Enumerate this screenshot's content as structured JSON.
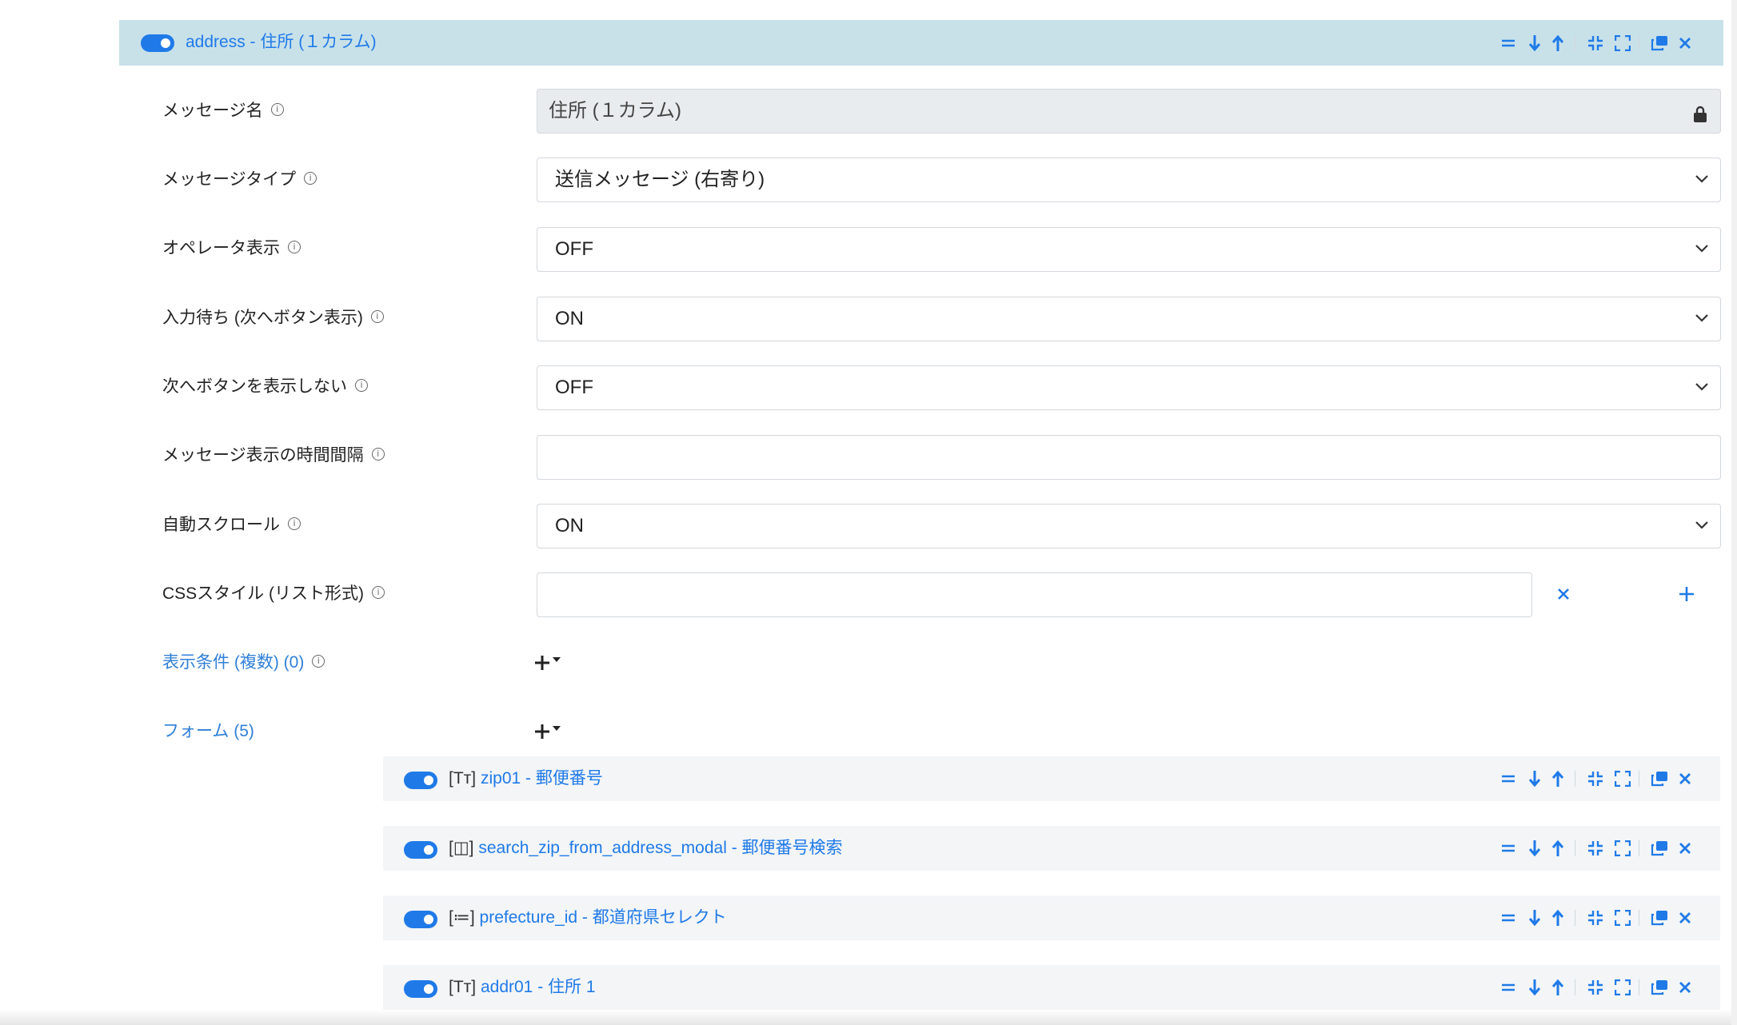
{
  "header": {
    "title": "address - 住所 (１カラム)",
    "toggle_on": true
  },
  "fields": [
    {
      "label": "メッセージ名",
      "value": "住所 (１カラム)",
      "type": "readonly"
    },
    {
      "label": "メッセージタイプ",
      "value": "送信メッセージ (右寄り)",
      "type": "select"
    },
    {
      "label": "オペレータ表示",
      "value": "OFF",
      "type": "select"
    },
    {
      "label": "入力待ち (次へボタン表示)",
      "value": "ON",
      "type": "select"
    },
    {
      "label": "次へボタンを表示しない",
      "value": "OFF",
      "type": "select"
    },
    {
      "label": "メッセージ表示の時間間隔",
      "value": "",
      "type": "text"
    },
    {
      "label": "自動スクロール",
      "value": "ON",
      "type": "select"
    },
    {
      "label": "CSSスタイル (リスト形式)",
      "value": "",
      "type": "text"
    }
  ],
  "conditions": {
    "label": "表示条件 (複数) (0)"
  },
  "forms": {
    "label": "フォーム (5)",
    "items": [
      {
        "icon": "[Tт]",
        "icon_name": "text-field-icon",
        "title": "zip01 - 郵便番号"
      },
      {
        "icon": "[◫]",
        "icon_name": "modal-icon",
        "title": "search_zip_from_address_modal - 郵便番号検索"
      },
      {
        "icon": "[≔]",
        "icon_name": "list-select-icon",
        "title": "prefecture_id - 都道府県セレクト"
      },
      {
        "icon": "[Tт]",
        "icon_name": "text-field-icon",
        "title": "addr01 - 住所 1"
      }
    ]
  },
  "info_glyph": "i",
  "colors": {
    "accent": "#1f7ae8",
    "header_bg": "#c8e1e9",
    "row_bg": "#f3f5f7",
    "readonly_bg": "#e9ecef"
  }
}
